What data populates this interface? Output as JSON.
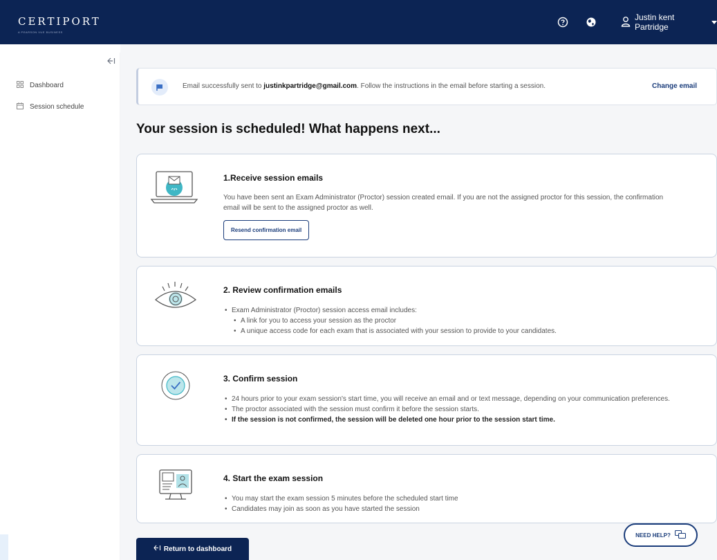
{
  "header": {
    "brand": "CERTIPORT",
    "brand_sub": "A PEARSON VUE BUSINESS",
    "help_icon": "help-circle-icon",
    "globe_icon": "globe-icon",
    "user_name": "Justin kent Partridge"
  },
  "sidebar": {
    "collapse_icon": "collapse-arrow-icon",
    "items": [
      {
        "label": "Dashboard",
        "icon": "dashboard-grid-icon"
      },
      {
        "label": "Session schedule",
        "icon": "calendar-icon"
      }
    ]
  },
  "alert": {
    "icon": "flag-icon",
    "prefix": "Email successfully sent to",
    "email": "justinkpartridge@gmail.com",
    "suffix": ". Follow the instructions in the email before starting a session.",
    "action": "Change email"
  },
  "page_title": "Your session is scheduled! What happens next...",
  "steps": [
    {
      "title": "1.Receive session emails",
      "illustration": "laptop-email-icon",
      "lines": [
        "You have been sent an Exam Administrator (Proctor) session created email. If you are not the assigned proctor for this session, the confirmation",
        "email will be sent to the assigned proctor as well."
      ],
      "button": "Resend confirmation email"
    },
    {
      "title": "2. Review confirmation emails",
      "illustration": "eye-icon",
      "bullets": [
        "Exam Administrator (Proctor) session access email includes:",
        "A link for you to access your session as the proctor",
        "A unique access code for each exam that is associated with your session to provide to your candidates."
      ]
    },
    {
      "title": "3. Confirm session",
      "illustration": "check-circle-icon",
      "bullets": [
        "24 hours prior to your exam session's start time, you will receive an email and or text message, depending on your communication preferences.",
        "The proctor associated with the session must confirm it before the session starts.",
        "If the session is not confirmed, the session will be deleted one hour prior to the session start time."
      ]
    },
    {
      "title": "4. Start the exam session",
      "illustration": "monitor-session-icon",
      "bullets": [
        "You may start the exam session 5 minutes before the scheduled start time",
        "Candidates may join as soon as you have started the session"
      ]
    }
  ],
  "footer": {
    "return_icon": "return-arrow-icon",
    "return_label": "Return to dashboard",
    "help_label": "NEED HELP?",
    "help_icon": "chat-bubbles-icon"
  },
  "colors": {
    "navy": "#0c2454",
    "link": "#1a3c7a",
    "accent_teal": "#3fb7c5",
    "card_border": "#c9d3e1",
    "main_bg": "#f5f6f8"
  }
}
